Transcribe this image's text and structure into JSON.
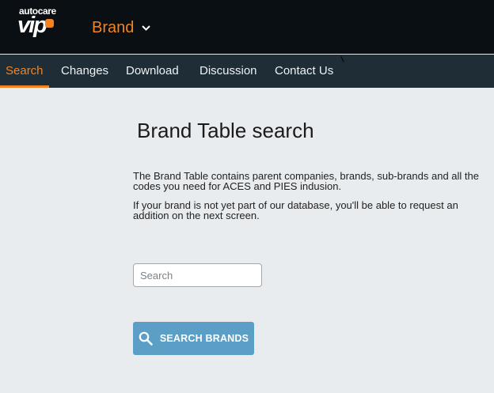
{
  "logo": {
    "top_text": "autocare",
    "main_text": "vip"
  },
  "header": {
    "brand_dropdown_label": "Brand"
  },
  "nav": {
    "items": [
      {
        "label": "Search",
        "active": true
      },
      {
        "label": "Changes",
        "active": false
      },
      {
        "label": "Download",
        "active": false
      },
      {
        "label": "Discussion",
        "active": false
      },
      {
        "label": "Contact Us",
        "active": false
      }
    ]
  },
  "main": {
    "title": "Brand Table search",
    "paragraph_1": "The Brand Table contains parent companies, brands, sub-brands and all the codes you need for ACES and PIES indusion.",
    "paragraph_2": "If your brand is not yet part of our database, you'll be able to request an addition on the next screen.",
    "search_placeholder": "Search",
    "search_value": "",
    "search_button_label": "SEARCH BRANDS"
  },
  "colors": {
    "accent": "#f58220",
    "topbar": "#0a0f14",
    "navbar": "#1f2d36",
    "page_background": "#e9ecef",
    "button": "#5b9fc7"
  },
  "icons": {
    "brand_dropdown": "chevron-down-icon",
    "search_button": "search-icon"
  }
}
